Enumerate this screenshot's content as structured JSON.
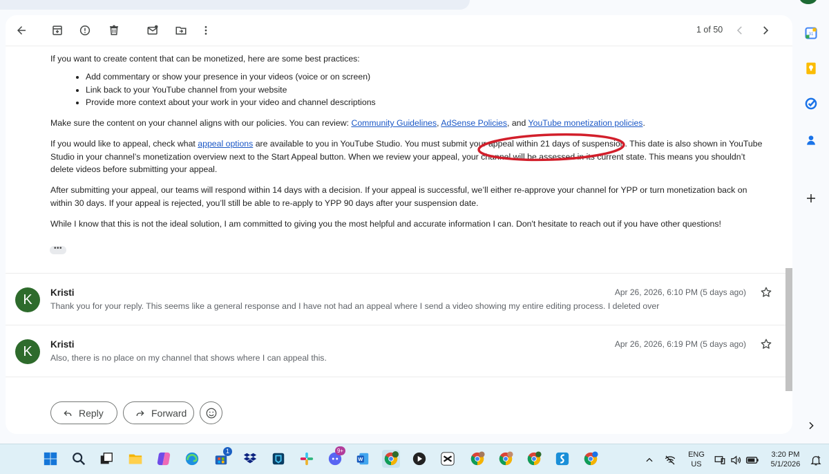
{
  "toolbar": {
    "pager_text": "1 of 50",
    "icons": [
      "back-arrow-icon",
      "archive-icon",
      "report-spam-icon",
      "delete-icon",
      "mark-unread-icon",
      "move-to-icon",
      "more-vert-icon",
      "older-chevron-icon",
      "newer-chevron-icon"
    ]
  },
  "email": {
    "p1": "If you want to create content that can be monetized, here are some best practices:",
    "bullets": [
      "Add commentary or show your presence in your videos (voice or on screen)",
      "Link back to your YouTube channel from your website",
      "Provide more context about your work in your video and channel descriptions"
    ],
    "p2_prefix": "Make sure the content on your channel aligns with our policies. You can review: ",
    "p2_link1": "Community Guidelines",
    "p2_sep1": ", ",
    "p2_link2": "AdSense Policies",
    "p2_sep2": ", and ",
    "p2_link3": "YouTube monetization policies",
    "p2_suffix": ".",
    "p3_prefix": "If you would like to appeal, check what ",
    "p3_link": "appeal options",
    "p3_suffix": " are available to you in YouTube Studio. You must submit your appeal within 21 days of suspension. This date is also shown in YouTube Studio in your channel’s monetization overview next to the Start Appeal button. When we review your appeal, your channel will be assessed in its current state. This means you shouldn’t delete videos before submitting your appeal.",
    "p4": "After submitting your appeal, our teams will respond within 14 days with a decision. If your appeal is successful, we’ll either re-approve your channel for YPP or turn monetization back on within 30 days. If your appeal is rejected, you’ll still be able to re-apply to YPP 90 days after your suspension date.",
    "p5": "While I know that this is not the ideal solution, I am committed to giving you the most helpful and accurate information I can. Don't hesitate to reach out if you have other questions!",
    "ellipsis": "•••",
    "annotation_color": "#d21f2b"
  },
  "messages": [
    {
      "avatar_letter": "K",
      "sender": "Kristi",
      "date": "Apr 26, 2026, 6:10 PM (5 days ago)",
      "snippet": "Thank you for your reply. This seems like a general response and I have not had an appeal where I send a video showing my entire editing process. I deleted over"
    },
    {
      "avatar_letter": "K",
      "sender": "Kristi",
      "date": "Apr 26, 2026, 6:19 PM (5 days ago)",
      "snippet": "Also, there is no place on my channel that shows where I can appeal this."
    }
  ],
  "actions": {
    "reply": "Reply",
    "forward": "Forward"
  },
  "side_panel": {
    "icons": [
      "google-calendar-icon",
      "google-keep-icon",
      "google-tasks-icon",
      "google-contacts-icon",
      "add-addon-icon",
      "expand-panel-icon"
    ],
    "calendar_day": "31"
  },
  "taskbar": {
    "apps": [
      "windows-start-icon",
      "search-icon",
      "task-view-icon",
      "file-explorer-icon",
      "copilot-icon",
      "edge-icon",
      "microsoft-store-icon",
      "dropbox-icon",
      "app-icon",
      "slack-icon",
      "discord-icon",
      "word-icon",
      "chrome-profile-k-icon",
      "media-player-icon",
      "capcut-icon",
      "chrome-icon",
      "chrome-profile-icon",
      "chrome-profile-k2-icon",
      "sideshift-icon",
      "chrome-yt-icon"
    ],
    "store_badge": "1",
    "discord_badge": "9+",
    "language_line1": "ENG",
    "language_line2": "US",
    "time": "3:20 PM",
    "date": "5/1/2026"
  },
  "colors": {
    "link": "#1a57c6",
    "avatar": "#2e6b2c",
    "taskbar": "#dff0f7"
  }
}
